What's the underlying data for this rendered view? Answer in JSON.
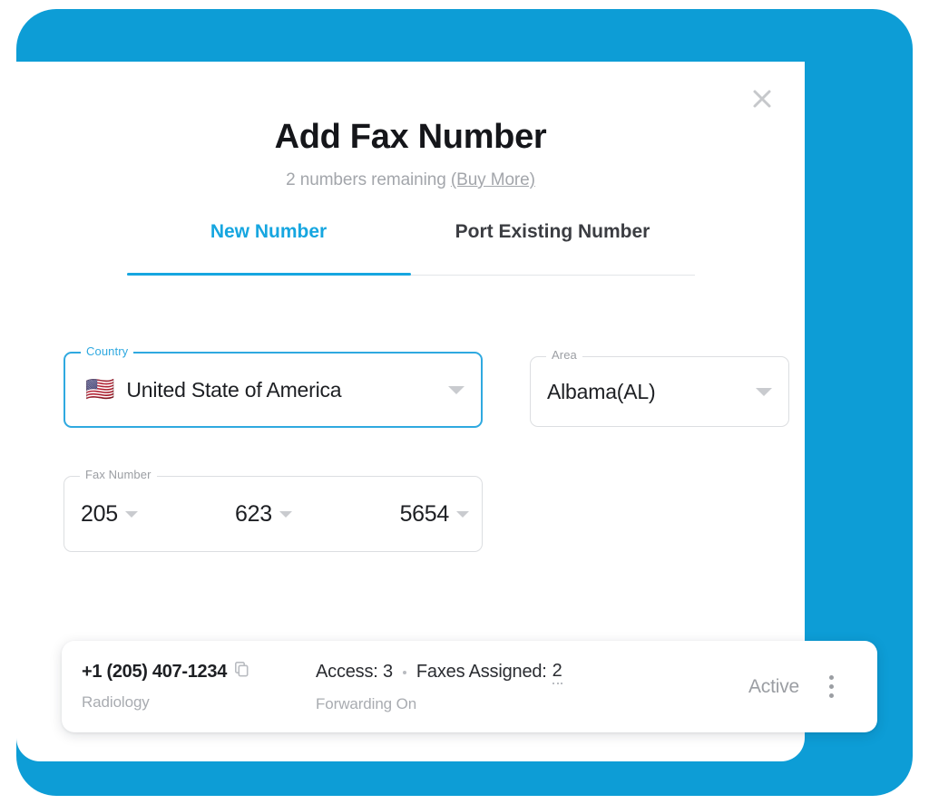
{
  "theme": {
    "brand_blue": "#0d9dd6",
    "accent_blue": "#16a6e0",
    "muted_text": "#a3a6ab",
    "body_text": "#1d1f23"
  },
  "dialog": {
    "title": "Add Fax Number",
    "subtitle_prefix": "2 numbers remaining ",
    "buy_more_label": "(Buy More)",
    "close_icon": "close-icon"
  },
  "tabs": [
    {
      "label": "New Number",
      "active": true
    },
    {
      "label": "Port Existing Number",
      "active": false
    }
  ],
  "form": {
    "country": {
      "legend": "Country",
      "value": "United State of America",
      "flag_icon": "🇺🇸",
      "focused": true,
      "caret_icon": "chevron-down-icon"
    },
    "area": {
      "legend": "Area",
      "value": "Albama(AL)",
      "focused": false,
      "caret_icon": "chevron-down-icon"
    },
    "fax_number": {
      "legend": "Fax Number",
      "segments": [
        {
          "value": "205"
        },
        {
          "value": "623"
        },
        {
          "value": "5654"
        }
      ]
    }
  },
  "number_card": {
    "phone": "+1 (205) 407-1234",
    "copy_icon": "copy-icon",
    "department": "Radiology",
    "access_label": "Access: 3",
    "faxes_assigned_label": "Faxes Assigned:",
    "faxes_assigned_value": "2",
    "forwarding": "Forwarding On",
    "status": "Active",
    "menu_icon": "more-vertical-icon"
  }
}
